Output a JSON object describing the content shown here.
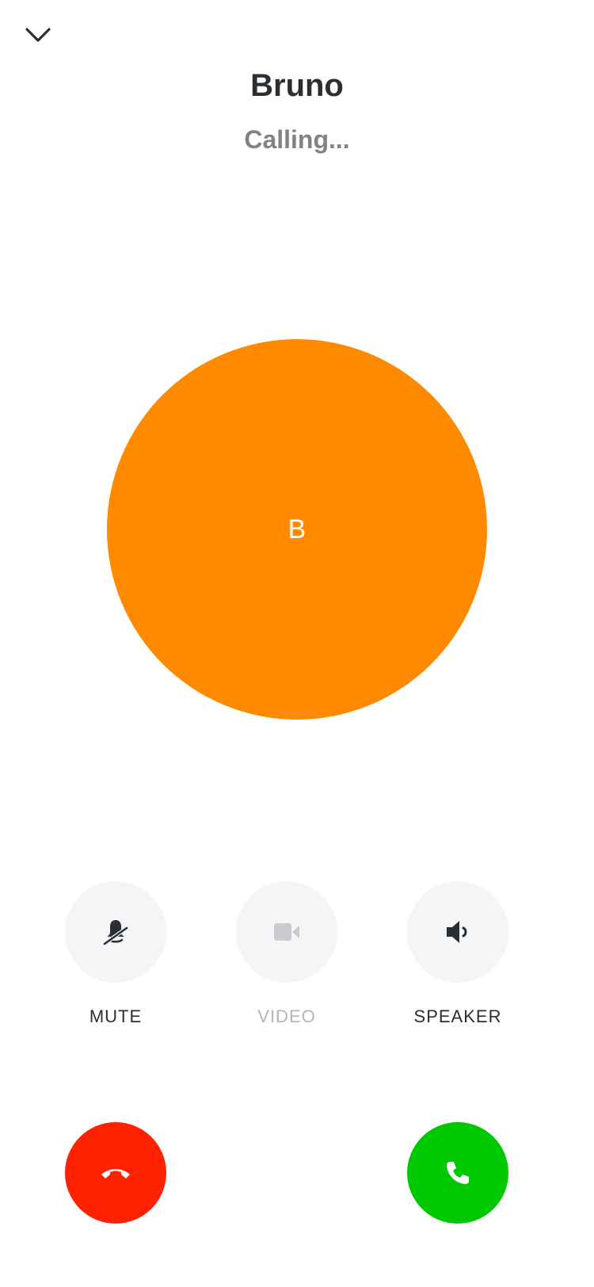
{
  "header": {
    "collapse_icon": "chevron-down-icon",
    "caller_name": "Bruno",
    "status": "Calling..."
  },
  "avatar": {
    "initial": "B",
    "color": "#ff8a00"
  },
  "controls": [
    {
      "label": "MUTE",
      "icon": "microphone-off-icon",
      "enabled": true
    },
    {
      "label": "VIDEO",
      "icon": "video-camera-icon",
      "enabled": false
    },
    {
      "label": "SPEAKER",
      "icon": "speaker-icon",
      "enabled": true
    }
  ],
  "actions": {
    "decline": {
      "icon": "phone-hangup-icon",
      "color": "#ff2200"
    },
    "accept": {
      "icon": "phone-icon",
      "color": "#00c800"
    }
  }
}
